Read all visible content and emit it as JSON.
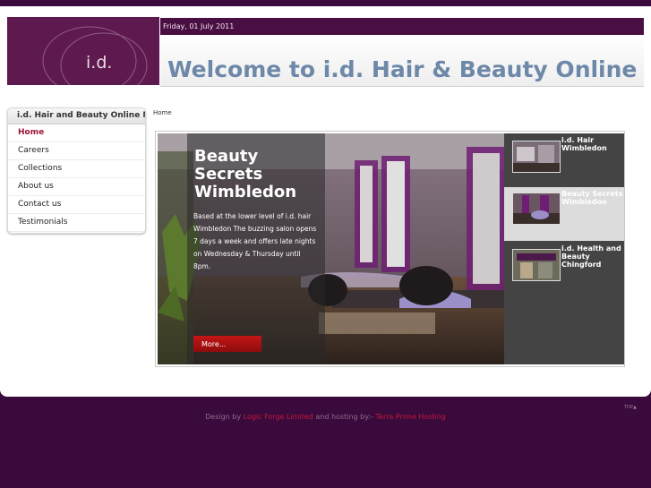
{
  "header": {
    "logo_text": "i.d.",
    "date": "Friday, 01 July 2011",
    "title": "Welcome to i.d. Hair & Beauty Online"
  },
  "menu": {
    "heading": "i.d. Hair and Beauty Online Menu",
    "items": [
      {
        "label": "Home",
        "active": true
      },
      {
        "label": "Careers"
      },
      {
        "label": "Collections"
      },
      {
        "label": "About us"
      },
      {
        "label": "Contact us"
      },
      {
        "label": "Testimonials"
      }
    ]
  },
  "breadcrumb": "Home",
  "slider": {
    "current_title": "Beauty Secrets Wimbledon",
    "current_text": "Based at the lower level of i.d. hair Wimbledon The buzzing salon opens 7 days a week and offers late nights on Wednesday & Thursday until 8pm.",
    "more_label": "More...",
    "thumbs": [
      {
        "label": "i.d. Hair Wimbledon"
      },
      {
        "label": "Beauty Secrets Wimbledon",
        "active": true
      },
      {
        "label": "i.d. Health and Beauty Chingford"
      }
    ]
  },
  "footer": {
    "prefix": "Design by",
    "designer": "Logic Forge Limited",
    "middle": "and hosting by:-",
    "host": "Terra Prime Hosting",
    "top_link": "TOP▲"
  }
}
